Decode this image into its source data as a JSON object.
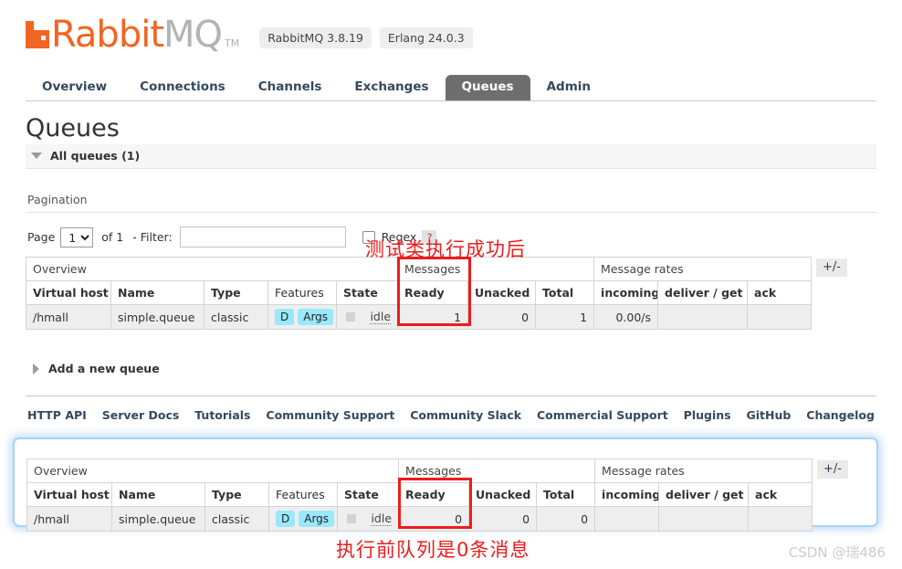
{
  "header": {
    "brand_rabbit": "Rabbit",
    "brand_mq": "MQ",
    "trademark": "TM",
    "version_badges": [
      "RabbitMQ 3.8.19",
      "Erlang 24.0.3"
    ],
    "logo_color": "#f26522"
  },
  "nav": {
    "tabs": [
      {
        "label": "Overview",
        "active": false
      },
      {
        "label": "Connections",
        "active": false
      },
      {
        "label": "Channels",
        "active": false
      },
      {
        "label": "Exchanges",
        "active": false
      },
      {
        "label": "Queues",
        "active": true
      },
      {
        "label": "Admin",
        "active": false
      }
    ]
  },
  "page": {
    "title": "Queues",
    "all_queues_label": "All queues (1)",
    "pagination_label": "Pagination",
    "add_queue_label": "Add a new queue"
  },
  "filter": {
    "page_label": "Page",
    "page_value": "1",
    "page_options": [
      "1"
    ],
    "of_label": "of 1",
    "filter_label": "- Filter:",
    "filter_value": "",
    "filter_placeholder": "",
    "regex_label": "Regex",
    "help_label": "?"
  },
  "table_top": {
    "group_headers": {
      "overview": "Overview",
      "messages": "Messages",
      "message_rates": "Message rates"
    },
    "columns": [
      "Virtual host",
      "Name",
      "Type",
      "Features",
      "State",
      "Ready",
      "Unacked",
      "Total",
      "incoming",
      "deliver / get",
      "ack"
    ],
    "row": {
      "virtual_host": "/hmall",
      "name": "simple.queue",
      "type": "classic",
      "features": [
        "D",
        "Args"
      ],
      "state": "idle",
      "ready": "1",
      "unacked": "0",
      "total": "1",
      "incoming": "0.00/s",
      "deliver_get": "",
      "ack": ""
    },
    "plusminus": "+/-"
  },
  "table_bottom": {
    "group_headers": {
      "overview": "Overview",
      "messages": "Messages",
      "message_rates": "Message rates"
    },
    "columns": [
      "Virtual host",
      "Name",
      "Type",
      "Features",
      "State",
      "Ready",
      "Unacked",
      "Total",
      "incoming",
      "deliver / get",
      "ack"
    ],
    "row": {
      "virtual_host": "/hmall",
      "name": "simple.queue",
      "type": "classic",
      "features": [
        "D",
        "Args"
      ],
      "state": "idle",
      "ready": "0",
      "unacked": "0",
      "total": "0",
      "incoming": "",
      "deliver_get": "",
      "ack": ""
    },
    "plusminus": "+/-"
  },
  "annotations": {
    "top_note": "测试类执行成功后",
    "bottom_note": "执行前队列是0条消息",
    "highlight_color": "#ee1c1c",
    "focus_color": "#a8d4f5"
  },
  "footer": {
    "links": [
      "HTTP API",
      "Server Docs",
      "Tutorials",
      "Community Support",
      "Community Slack",
      "Commercial Support",
      "Plugins",
      "GitHub",
      "Changelog"
    ]
  },
  "watermark": "CSDN @瑞486"
}
